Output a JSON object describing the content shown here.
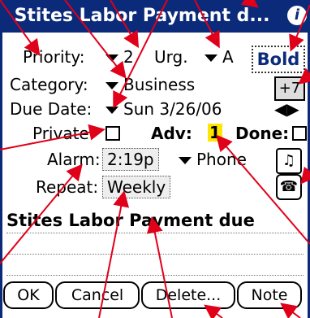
{
  "title": "Stites Labor Payment d...",
  "info_icon": "i",
  "fields": {
    "priority_label": "Priority:",
    "priority_value": "2",
    "urgency_label": "Urg.",
    "urgency_value": "A",
    "style_value": "Bold",
    "category_label": "Category:",
    "category_value": "Business",
    "category_extra": "+7",
    "due_label": "Due Date:",
    "due_value": "Sun 3/26/06",
    "private_label": "Private:",
    "adv_label": "Adv:",
    "adv_value": "1",
    "done_label": "Done:",
    "alarm_label": "Alarm:",
    "alarm_value": "2:19p",
    "alarm_type": "Phone",
    "repeat_label": "Repeat:",
    "repeat_value": "Weekly"
  },
  "description": "Stites Labor Payment due",
  "buttons": {
    "ok": "OK",
    "cancel": "Cancel",
    "delete": "Delete...",
    "note": "Note"
  },
  "icons": {
    "date_arrows": "◀▶",
    "music": "♫",
    "phone": "☎"
  },
  "colors": {
    "title_bar": "#0b2a7a",
    "annotation_arrows": "#e0001a",
    "adv_highlight": "#ffe600"
  }
}
